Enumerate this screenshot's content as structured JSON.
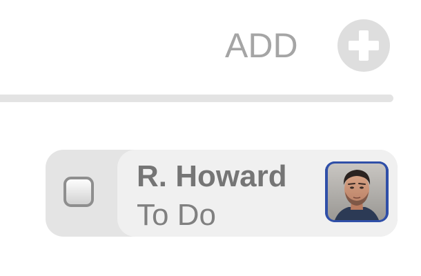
{
  "header": {
    "add_label": "ADD",
    "add_icon": "plus-icon"
  },
  "task": {
    "assignee": "R. Howard",
    "status": "To Do",
    "checked": false,
    "avatar_icon": "avatar-photo"
  },
  "colors": {
    "text_muted": "#a5a5a5",
    "card_bg": "#f0f0f0",
    "card_edge": "#e4e4e4",
    "avatar_frame": "#2f4fa8"
  }
}
